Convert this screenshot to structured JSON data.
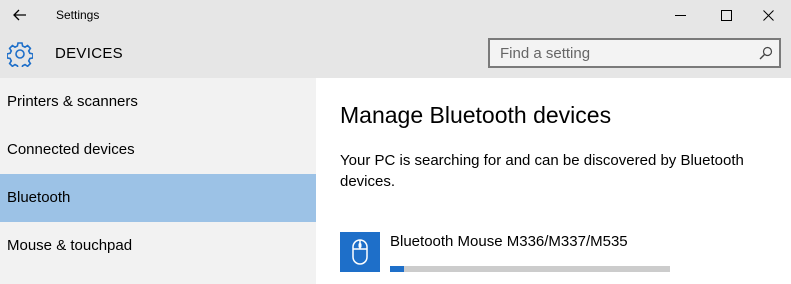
{
  "window": {
    "title": "Settings",
    "icons": {
      "back": "back-arrow-icon",
      "minimize": "minimize-icon",
      "maximize": "maximize-icon",
      "close": "close-icon"
    }
  },
  "header": {
    "section_title": "DEVICES",
    "icon": "gear-icon",
    "search": {
      "placeholder": "Find a setting",
      "value": "",
      "icon": "search-icon"
    }
  },
  "sidebar": {
    "items": [
      {
        "label": "Printers & scanners",
        "selected": false
      },
      {
        "label": "Connected devices",
        "selected": false
      },
      {
        "label": "Bluetooth",
        "selected": true
      },
      {
        "label": "Mouse & touchpad",
        "selected": false
      }
    ]
  },
  "main": {
    "title": "Manage Bluetooth devices",
    "description": "Your PC is searching for and can be discovered by Bluetooth devices.",
    "devices": [
      {
        "name": "Bluetooth Mouse M336/M337/M535",
        "icon": "mouse-icon",
        "progress": 0.05
      }
    ]
  },
  "colors": {
    "accent": "#1e6fc9",
    "selected_nav": "#9cc2e6",
    "header_bg": "#e6e6e6",
    "sidebar_bg": "#f2f2f2"
  }
}
